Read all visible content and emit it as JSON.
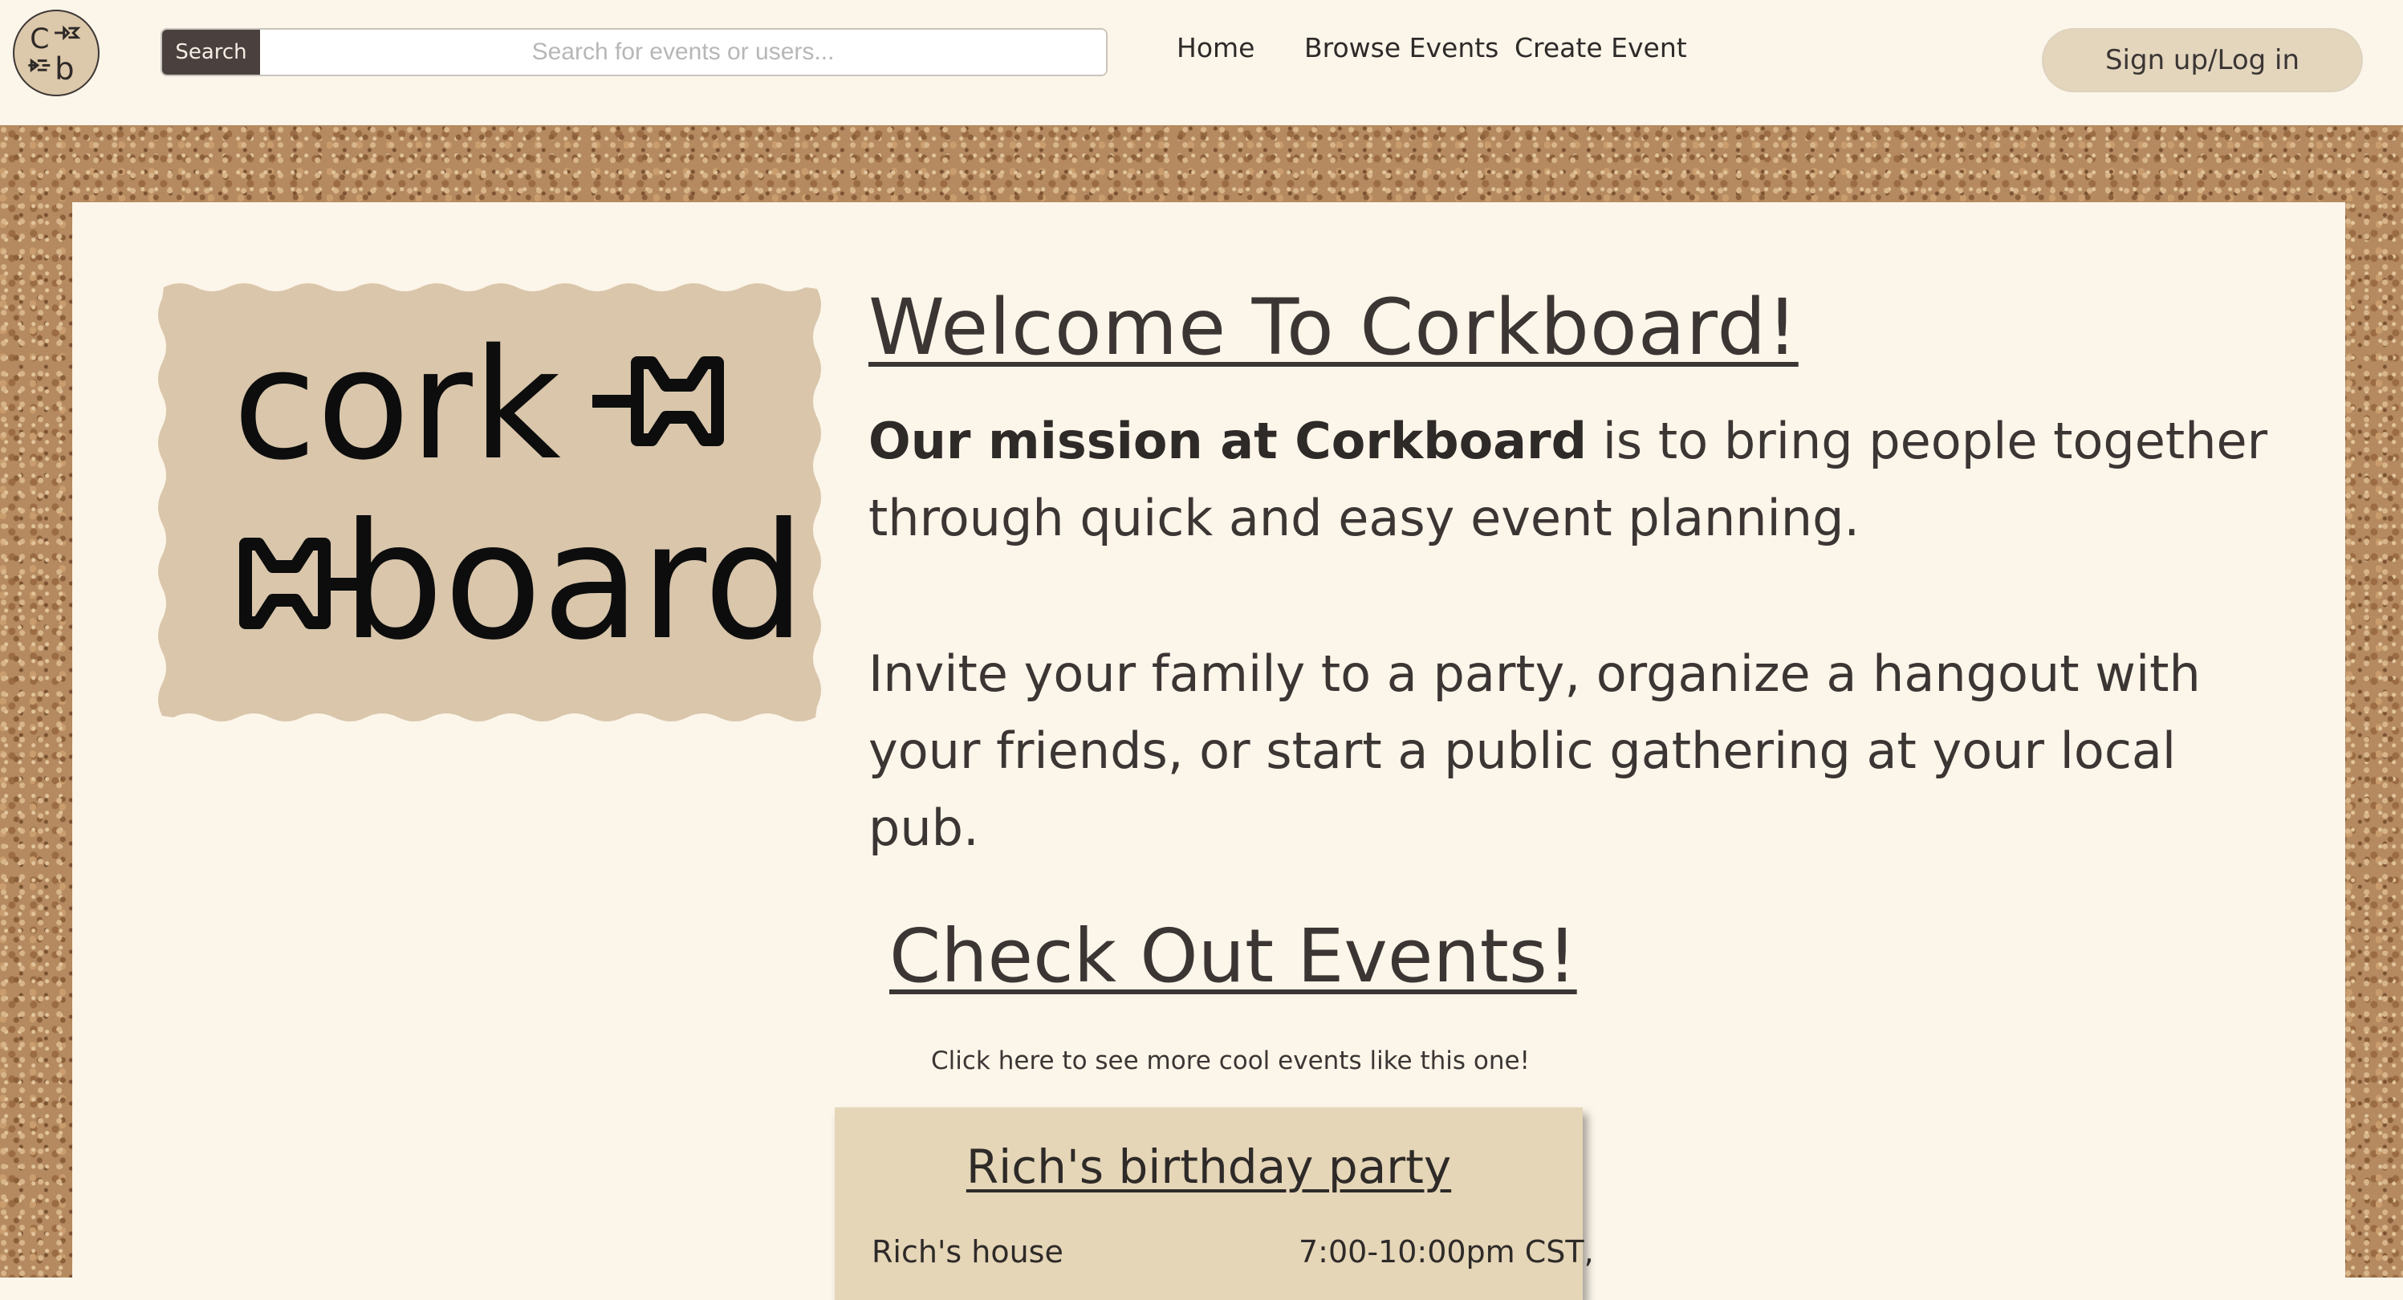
{
  "navbar": {
    "search_button": "Search",
    "search_placeholder": "Search for events or users...",
    "links": [
      "Home",
      "Browse Events",
      "Create Event"
    ],
    "auth_button": "Sign up/Log in",
    "logo_icon": "corkboard-logo-icon"
  },
  "hero": {
    "logo_text_line1": "cork",
    "logo_text_line2": "board",
    "logo_icon": "pushpin-icon",
    "logo_bg": "#d9c6ab",
    "title": "Welcome To Corkboard!",
    "mission_bold": "Our mission at Corkboard",
    "mission_rest": " is to bring people together through quick and easy event planning.",
    "invite": "Invite your family to a party, organize a hangout with your friends, or start a public gathering at your local pub."
  },
  "events": {
    "title": "Check Out Events!",
    "link_text": "Click here to see more cool events like this one!",
    "featured": {
      "title": "Rich's birthday party",
      "location": "Rich's house",
      "time": "7:00-10:00pm CST,"
    }
  },
  "colors": {
    "page_bg": "#fbf5ea",
    "card_bg": "#fcf5e9",
    "event_card_bg": "#e5d6b8",
    "search_button_bg": "#4a413e",
    "auth_button_bg": "#e3d6bd",
    "text": "#3b3634",
    "cork": "#b58a60"
  }
}
